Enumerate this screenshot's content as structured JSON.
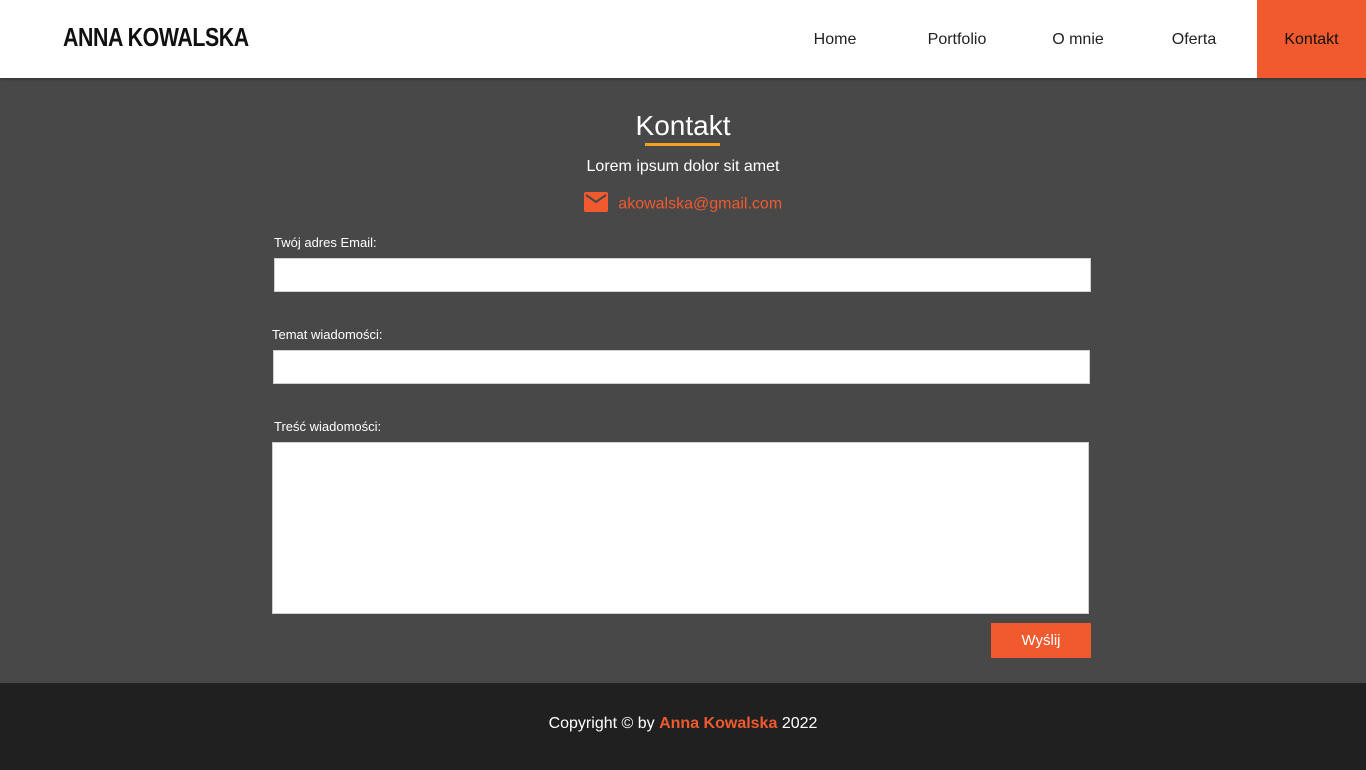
{
  "header": {
    "logo": "ANNA KOWALSKA",
    "nav": [
      {
        "label": "Home"
      },
      {
        "label": "Portfolio"
      },
      {
        "label": "O mnie"
      },
      {
        "label": "Oferta"
      },
      {
        "label": "Kontakt",
        "active": true
      }
    ]
  },
  "main": {
    "title": "Kontakt",
    "subtitle": "Lorem ipsum dolor sit amet",
    "email": "akowalska@gmail.com",
    "email_icon": "mail-icon",
    "form": {
      "email_label": "Twój adres Email:",
      "email_value": "",
      "subject_label": "Temat wiadomości:",
      "subject_value": "",
      "message_label": "Treść wiadomości:",
      "message_value": "",
      "send_label": "Wyślij"
    }
  },
  "footer": {
    "prefix": "Copyright © by",
    "name": "Anna Kowalska",
    "year": "2022"
  },
  "colors": {
    "accent": "#f05a2e",
    "title_underline": "#f5a020",
    "background": "#484848",
    "footer": "#202020",
    "header": "#ffffff"
  }
}
